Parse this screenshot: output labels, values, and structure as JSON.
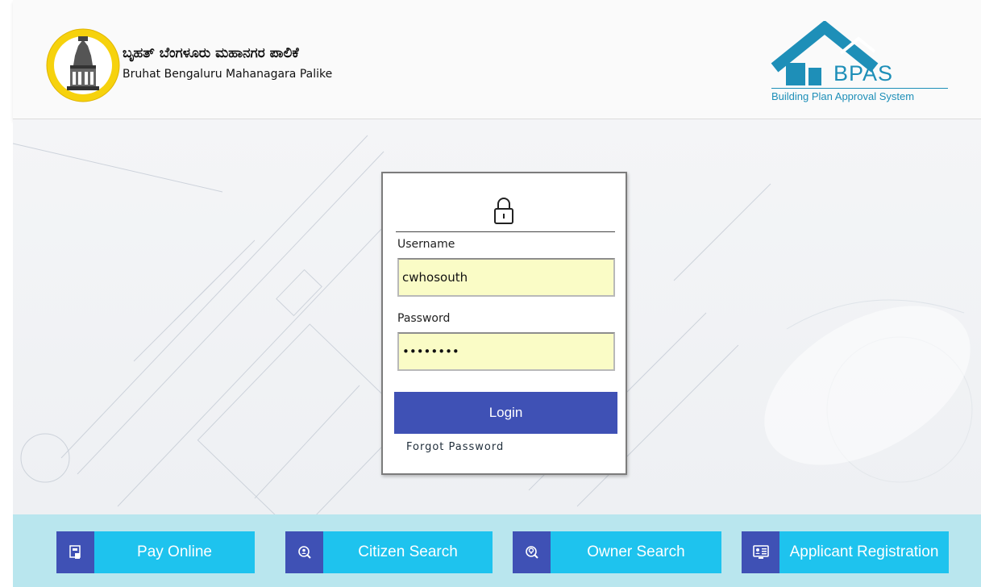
{
  "header": {
    "org_name_kannada": "ಬೃಹತ್ ಬೆಂಗಳೂರು ಮಹಾನಗರ ಪಾಲಿಕೆ",
    "org_name_english": "Bruhat Bengaluru Mahanagara Palike",
    "bpas_logo_text": "BPAS",
    "bpas_tagline": "Building Plan Approval System",
    "emblem_icon": "bbmp-emblem-icon"
  },
  "login": {
    "icon": "lock-icon",
    "username_label": "Username",
    "username_value": "cwhosouth",
    "password_label": "Password",
    "password_value": "••••••••",
    "login_button": "Login",
    "forgot_link": "Forgot Password"
  },
  "quick_links": [
    {
      "label": "Pay Online",
      "icon": "payment-icon"
    },
    {
      "label": "Citizen Search",
      "icon": "search-person-icon"
    },
    {
      "label": "Owner Search",
      "icon": "location-search-icon"
    },
    {
      "label": "Applicant Registration",
      "icon": "registration-icon"
    }
  ],
  "colors": {
    "primary_blue": "#3f51b5",
    "cyan": "#1ec3ee",
    "footer_bg": "#b9e6ee",
    "bpas_blue": "#1e8fb8",
    "input_bg": "#fafcc6"
  }
}
